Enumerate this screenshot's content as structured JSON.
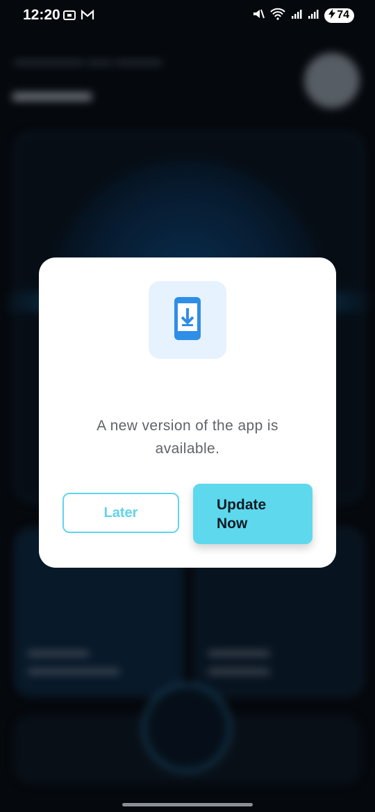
{
  "status_bar": {
    "time": "12:20",
    "battery": "74",
    "icons": [
      "screenshot-icon",
      "gmail-icon",
      "mute-icon",
      "wifi-icon",
      "signal-icon",
      "signal-icon",
      "battery-icon"
    ]
  },
  "dialog": {
    "icon": "phone-download-icon",
    "message": "A new version of the app is available.",
    "later_label": "Later",
    "update_label": "Update Now",
    "accent_color": "#5ed8ed",
    "icon_color": "#2f8ee6"
  }
}
